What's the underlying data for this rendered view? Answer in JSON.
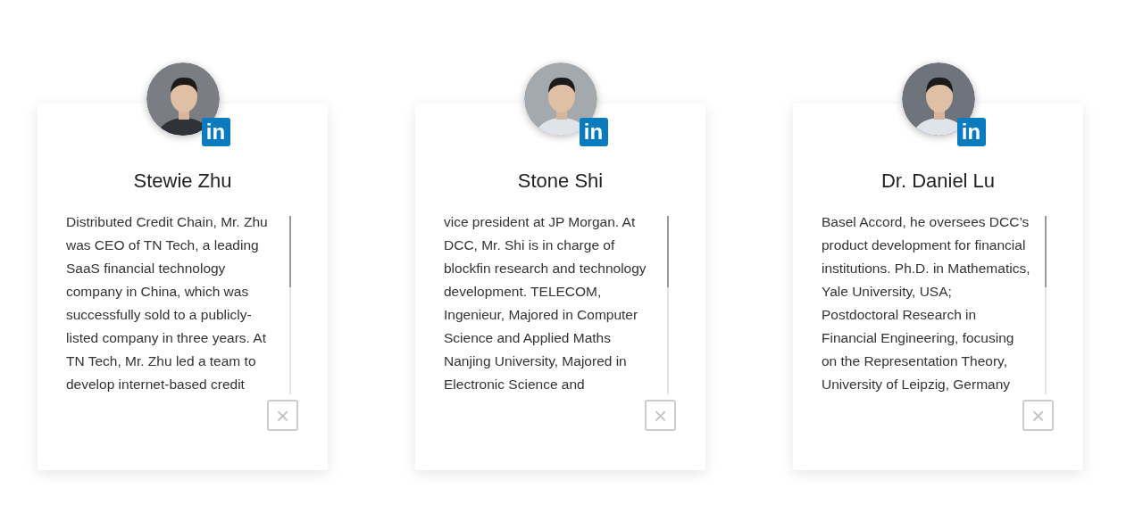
{
  "cards": [
    {
      "name": "Stewie Zhu",
      "badge": "in",
      "bio": "Distributed Credit Chain, Mr. Zhu was CEO of TN Tech, a leading SaaS financial technology company in China, which was successfully sold to a publicly-listed company in three years. At TN Tech, Mr. Zhu led a team to develop internet-based credit",
      "close": "×"
    },
    {
      "name": "Stone Shi",
      "badge": "in",
      "bio": "vice president at JP Morgan. At DCC, Mr. Shi is in charge of blockfin research and technology development. TELECOM, Ingenieur, Majored in Computer Science and Applied Maths Nanjing University, Majored in Electronic Science and",
      "close": "×"
    },
    {
      "name": "Dr. Daniel Lu",
      "badge": "in",
      "bio": "Basel Accord, he oversees DCC’s product development for financial institutions. Ph.D. in Mathematics, Yale University, USA; Postdoctoral Research in Financial Engineering, focusing on the Representation Theory, University of Leipzig, Germany",
      "close": "×"
    }
  ]
}
